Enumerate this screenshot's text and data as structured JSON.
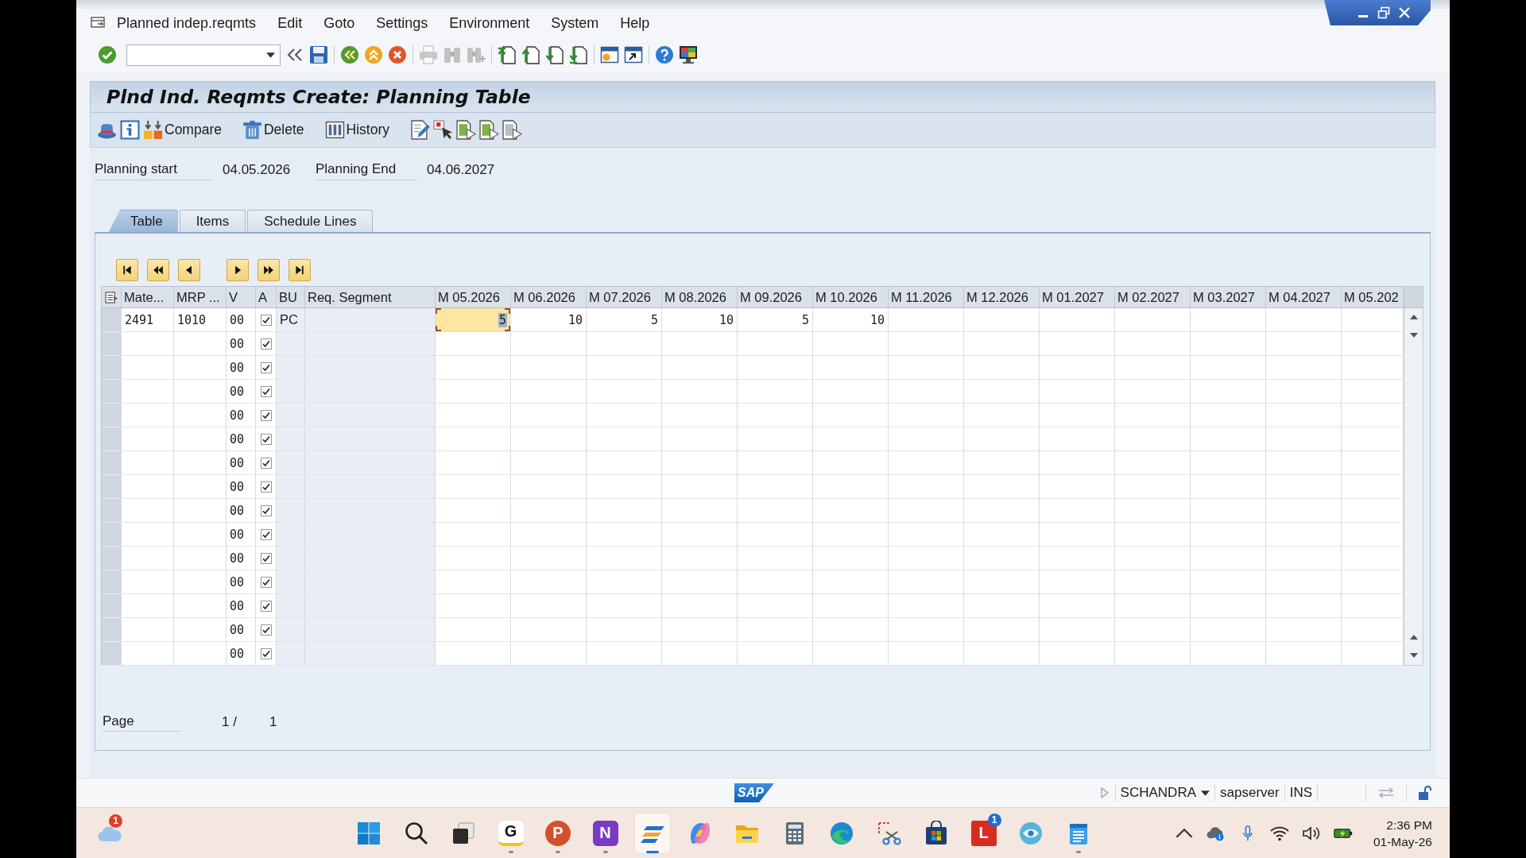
{
  "menu_bar": {
    "items": [
      "Planned indep.reqmts",
      "Edit",
      "Goto",
      "Settings",
      "Environment",
      "System",
      "Help"
    ]
  },
  "system_toolbar": {
    "groups": [
      [
        {
          "kind": "enter",
          "disabled": false
        }
      ],
      [
        {
          "kind": "collapse",
          "disabled": false
        },
        {
          "kind": "save",
          "disabled": false
        }
      ],
      [
        {
          "kind": "back",
          "disabled": false
        },
        {
          "kind": "exit",
          "disabled": false
        },
        {
          "kind": "cancel",
          "disabled": false
        }
      ],
      [
        {
          "kind": "print",
          "disabled": true
        },
        {
          "kind": "find",
          "disabled": true
        },
        {
          "kind": "find_next",
          "disabled": true
        }
      ],
      [
        {
          "kind": "first_page",
          "disabled": false
        },
        {
          "kind": "previous_page",
          "disabled": false
        },
        {
          "kind": "next_page",
          "disabled": false
        },
        {
          "kind": "last_page",
          "disabled": false
        }
      ],
      [
        {
          "kind": "new_session",
          "disabled": false
        },
        {
          "kind": "shortcut",
          "disabled": false
        }
      ],
      [
        {
          "kind": "help",
          "disabled": false
        },
        {
          "kind": "customize",
          "disabled": false
        }
      ]
    ]
  },
  "title": "Plnd Ind. Reqmts Create: Planning Table",
  "application_toolbar": {
    "items": [
      {
        "kind": "hat"
      },
      {
        "kind": "info"
      },
      {
        "kind": "compare",
        "label": "Compare"
      },
      {
        "kind": "delete",
        "label": "Delete"
      },
      {
        "kind": "history",
        "label": "History"
      },
      {
        "kind": "edit"
      },
      {
        "kind": "select"
      },
      {
        "kind": "doc_green"
      },
      {
        "kind": "doc_green"
      },
      {
        "kind": "doc_gray"
      }
    ]
  },
  "header_fields": [
    {
      "label": "Planning start",
      "value": "04.05.2026"
    },
    {
      "label": "Planning End",
      "value": "04.06.2027"
    }
  ],
  "tabs": [
    {
      "label": "Table",
      "selected": true
    },
    {
      "label": "Items",
      "selected": false
    },
    {
      "label": "Schedule Lines",
      "selected": false
    }
  ],
  "table": {
    "columns": [
      "Mate...",
      "MRP ...",
      "V",
      "A",
      "BU",
      "Req. Segment",
      "M 05.2026",
      "M 06.2026",
      "M 07.2026",
      "M 08.2026",
      "M 09.2026",
      "M 10.2026",
      "M 11.2026",
      "M 12.2026",
      "M 01.2027",
      "M 02.2027",
      "M 03.2027",
      "M 04.2027",
      "M 05.202"
    ],
    "rows": [
      {
        "mate": "2491",
        "mrp": "1010",
        "v": "00",
        "a_checked": true,
        "bu": "PC",
        "months": [
          {
            "value": "5",
            "selected": true
          },
          {
            "value": "10",
            "selected": false
          },
          {
            "value": "5",
            "selected": false
          },
          {
            "value": "10",
            "selected": false
          },
          {
            "value": "5",
            "selected": false
          },
          {
            "value": "10",
            "selected": false
          }
        ]
      },
      {
        "v": "00",
        "a_checked": true
      },
      {
        "v": "00",
        "a_checked": true
      },
      {
        "v": "00",
        "a_checked": true
      },
      {
        "v": "00",
        "a_checked": true
      },
      {
        "v": "00",
        "a_checked": true
      },
      {
        "v": "00",
        "a_checked": true
      },
      {
        "v": "00",
        "a_checked": true
      },
      {
        "v": "00",
        "a_checked": true
      },
      {
        "v": "00",
        "a_checked": true
      },
      {
        "v": "00",
        "a_checked": true
      },
      {
        "v": "00",
        "a_checked": true
      },
      {
        "v": "00",
        "a_checked": true
      },
      {
        "v": "00",
        "a_checked": true
      },
      {
        "v": "00",
        "a_checked": true
      }
    ]
  },
  "page": {
    "label": "Page",
    "current": "1 /",
    "total": "1"
  },
  "status_bar": {
    "logo": "SAP",
    "user": "SCHANDRA",
    "server": "sapserver",
    "mode": "INS"
  },
  "taskbar": {
    "weather": {
      "badge": "1"
    },
    "apps": [
      {
        "kind": "start",
        "running": false,
        "selected": false
      },
      {
        "kind": "search",
        "running": false,
        "selected": false
      },
      {
        "kind": "task_view",
        "running": false,
        "selected": false
      },
      {
        "kind": "letter_g",
        "glyph": "G",
        "running": true,
        "selected": false
      },
      {
        "kind": "letter_p",
        "glyph": "P",
        "running": true,
        "selected": false
      },
      {
        "kind": "letter_n",
        "glyph": "N",
        "running": true,
        "selected": false
      },
      {
        "kind": "slanted_bars",
        "running": true,
        "selected": true
      },
      {
        "kind": "swirl",
        "running": false,
        "selected": false
      },
      {
        "kind": "folder",
        "running": false,
        "selected": false
      },
      {
        "kind": "calculator",
        "running": false,
        "selected": false
      },
      {
        "kind": "browser",
        "running": false,
        "selected": false
      },
      {
        "kind": "scissors",
        "running": false,
        "selected": false
      },
      {
        "kind": "bag",
        "running": false,
        "selected": false
      },
      {
        "kind": "letter_l",
        "glyph": "L",
        "badge": "1",
        "running": false,
        "selected": false
      },
      {
        "kind": "eye",
        "running": false,
        "selected": false
      },
      {
        "kind": "notepad",
        "running": true,
        "selected": false
      }
    ],
    "clock": {
      "time": "2:36 PM",
      "date": "01-May-26"
    }
  }
}
